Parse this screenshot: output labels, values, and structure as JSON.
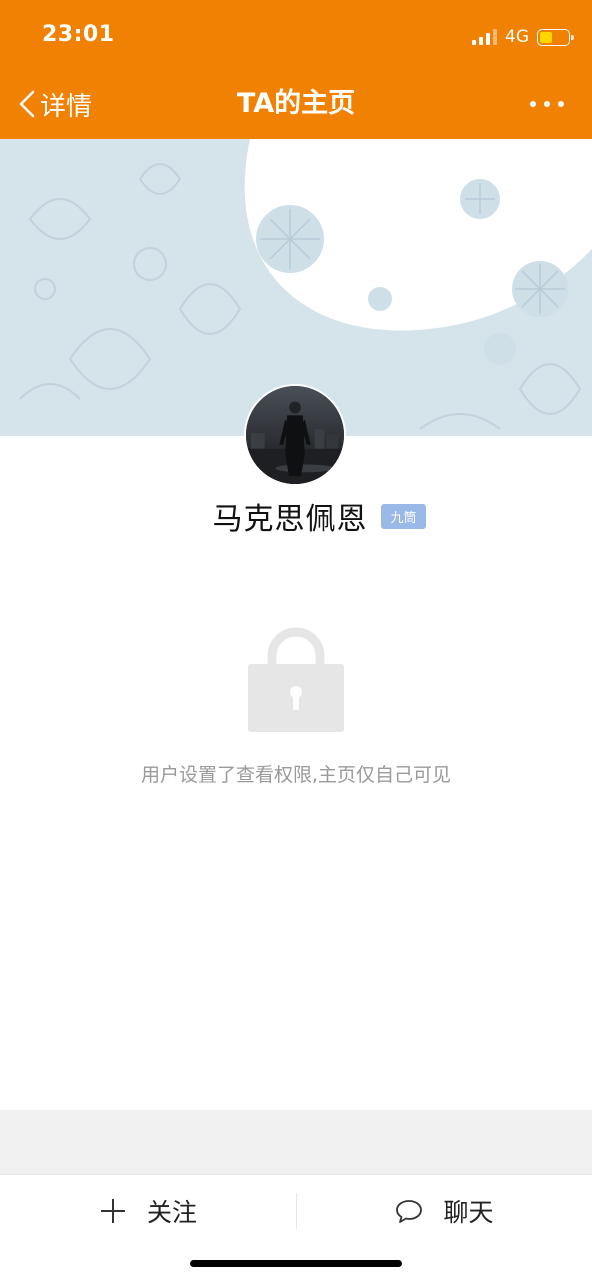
{
  "status_bar": {
    "time": "23:01",
    "network": "4G",
    "battery_level": 0.45,
    "icons": [
      "signal-icon",
      "battery-icon"
    ]
  },
  "nav": {
    "back_label": "详情",
    "title": "TA的主页",
    "icons": [
      "chevron-left-icon",
      "more-icon"
    ]
  },
  "profile": {
    "name": "马克思佩恩",
    "badge": "九筒"
  },
  "privacy": {
    "icon": "lock-icon",
    "message": "用户设置了查看权限,主页仅自己可见"
  },
  "bottom_bar": {
    "follow_label": "关注",
    "chat_label": "聊天",
    "icons": [
      "plus-icon",
      "chat-bubble-icon"
    ]
  },
  "colors": {
    "header": "#f08102",
    "cover": "#d5e3ea",
    "badge": "#9ab8e8",
    "notice_text": "#9a9a9a",
    "lock": "#e6e6e6"
  }
}
